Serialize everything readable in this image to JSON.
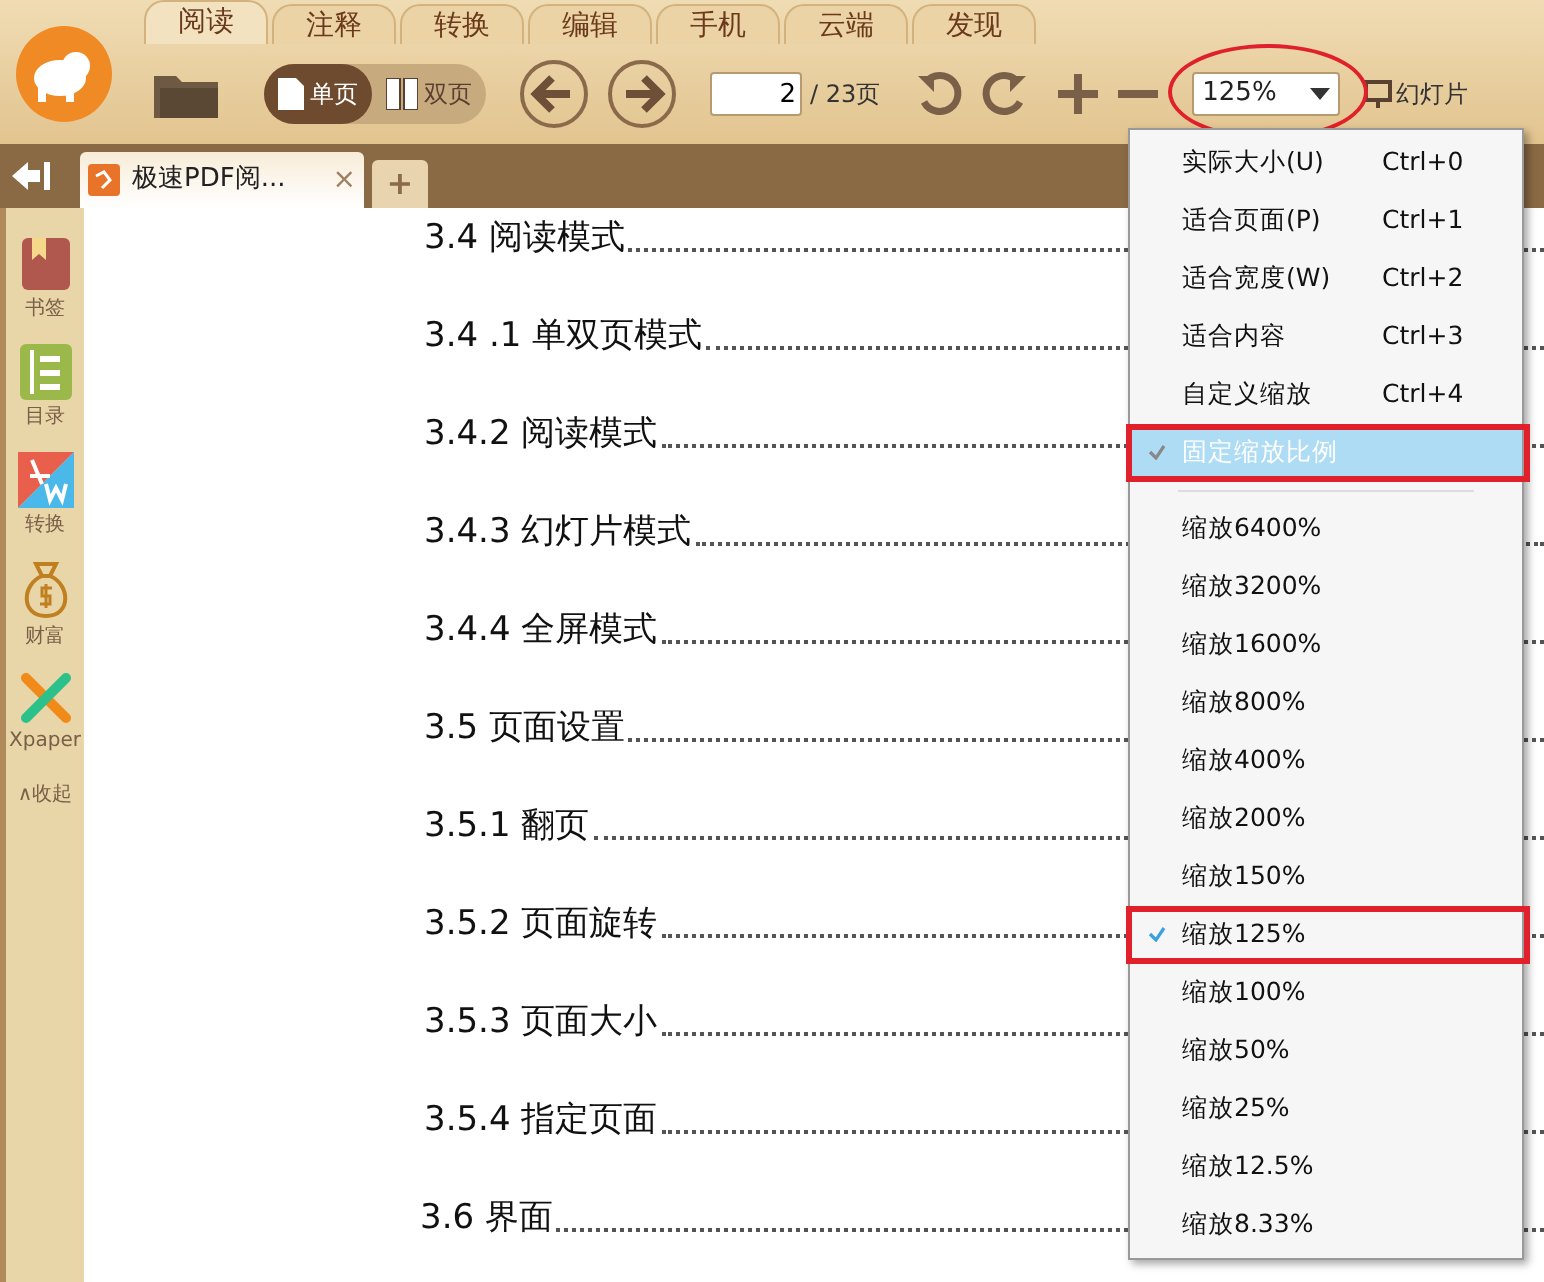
{
  "ribbon_tabs": [
    {
      "label": "阅读",
      "selected": true
    },
    {
      "label": "注释",
      "selected": false
    },
    {
      "label": "转换",
      "selected": false
    },
    {
      "label": "编辑",
      "selected": false
    },
    {
      "label": "手机",
      "selected": false
    },
    {
      "label": "云端",
      "selected": false
    },
    {
      "label": "发现",
      "selected": false
    }
  ],
  "toolbar": {
    "view_modes": [
      {
        "label": "单页",
        "selected": true
      },
      {
        "label": "双页",
        "selected": false
      }
    ],
    "page_input": "2",
    "page_total": "/ 23页",
    "zoom_value": "125%",
    "zoom_annotated": true,
    "slideshow": "幻灯片"
  },
  "doc_tab": {
    "title": "极速PDF阅...",
    "close": "×",
    "new_tab": "+"
  },
  "sidebar": {
    "items": [
      {
        "kind": "bookmark",
        "label": "书签"
      },
      {
        "kind": "toc",
        "label": "目录"
      },
      {
        "kind": "convert",
        "label": "转换"
      },
      {
        "kind": "money",
        "label": "财富"
      },
      {
        "kind": "xpaper",
        "label": "Xpaper"
      }
    ],
    "collapse": "∧收起"
  },
  "document": {
    "toc": [
      "3.4 阅读模式",
      "3.4 .1 单双页模式",
      "3.4.2 阅读模式",
      "3.4.3 幻灯片模式",
      "3.4.4 全屏模式",
      "3.5 页面设置",
      "3.5.1 翻页",
      "3.5.2 页面旋转",
      "3.5.3 页面大小",
      "3.5.4 指定页面",
      "3.6 界面"
    ]
  },
  "zoom_menu": [
    {
      "label": "实际大小(U)",
      "shortcut": "Ctrl+0",
      "checked": false,
      "highlighted": false,
      "annotated": false
    },
    {
      "label": "适合页面(P)",
      "shortcut": "Ctrl+1",
      "checked": false,
      "highlighted": false,
      "annotated": false
    },
    {
      "label": "适合宽度(W)",
      "shortcut": "Ctrl+2",
      "checked": false,
      "highlighted": false,
      "annotated": false
    },
    {
      "label": "适合内容",
      "shortcut": "Ctrl+3",
      "checked": false,
      "highlighted": false,
      "annotated": false
    },
    {
      "label": "自定义缩放",
      "shortcut": "Ctrl+4",
      "checked": false,
      "highlighted": false,
      "annotated": false
    },
    {
      "label": "固定缩放比例",
      "checked": true,
      "highlighted": true,
      "annotated": true,
      "separator_after": true
    },
    {
      "label": "缩放6400%",
      "checked": false,
      "highlighted": false,
      "annotated": false
    },
    {
      "label": "缩放3200%",
      "checked": false,
      "highlighted": false,
      "annotated": false
    },
    {
      "label": "缩放1600%",
      "checked": false,
      "highlighted": false,
      "annotated": false
    },
    {
      "label": "缩放800%",
      "checked": false,
      "highlighted": false,
      "annotated": false
    },
    {
      "label": "缩放400%",
      "checked": false,
      "highlighted": false,
      "annotated": false
    },
    {
      "label": "缩放200%",
      "checked": false,
      "highlighted": false,
      "annotated": false
    },
    {
      "label": "缩放150%",
      "checked": false,
      "highlighted": false,
      "annotated": false
    },
    {
      "label": "缩放125%",
      "checked": true,
      "highlighted": false,
      "annotated": true
    },
    {
      "label": "缩放100%",
      "checked": false,
      "highlighted": false,
      "annotated": false
    },
    {
      "label": "缩放50%",
      "checked": false,
      "highlighted": false,
      "annotated": false
    },
    {
      "label": "缩放25%",
      "checked": false,
      "highlighted": false,
      "annotated": false
    },
    {
      "label": "缩放12.5%",
      "checked": false,
      "highlighted": false,
      "annotated": false
    },
    {
      "label": "缩放8.33%",
      "checked": false,
      "highlighted": false,
      "annotated": false
    }
  ]
}
